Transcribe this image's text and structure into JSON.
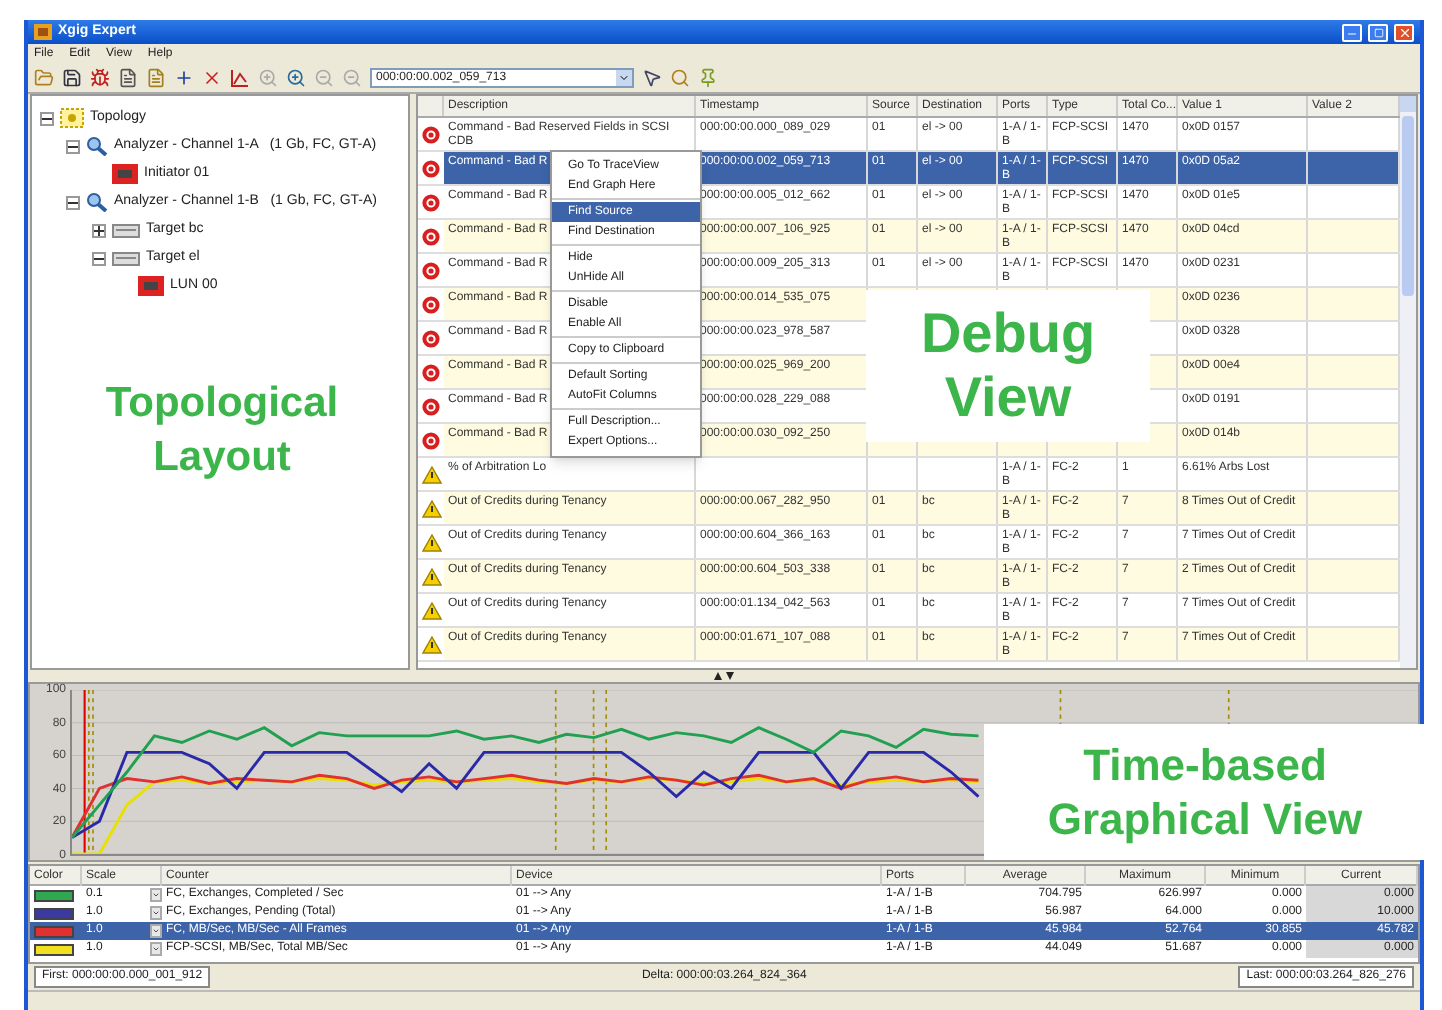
{
  "window": {
    "title": "Xgig Expert"
  },
  "menu": [
    "File",
    "Edit",
    "View",
    "Help"
  ],
  "toolbar": {
    "time_field": "000:00:00.002_059_713"
  },
  "tree": {
    "items": [
      {
        "label": "Topology",
        "kind": "topology",
        "expanded": true,
        "children": [
          {
            "label": "Analyzer - Channel 1-A   (1 Gb, FC, GT-A)",
            "kind": "analyzer",
            "expanded": true,
            "children": [
              {
                "label": "Initiator 01",
                "kind": "initiator"
              }
            ]
          },
          {
            "label": "Analyzer - Channel 1-B   (1 Gb, FC, GT-A)",
            "kind": "analyzer",
            "expanded": true,
            "children": [
              {
                "label": "Target bc",
                "kind": "target",
                "expanded": false
              },
              {
                "label": "Target el",
                "kind": "target",
                "expanded": true,
                "children": [
                  {
                    "label": "LUN 00",
                    "kind": "lun"
                  }
                ]
              }
            ]
          }
        ]
      }
    ],
    "callout": "Topological Layout"
  },
  "events": {
    "columns": [
      "Description",
      "Timestamp",
      "Source",
      "Destination",
      "Ports",
      "Type",
      "Total Co...",
      "Value 1",
      "Value 2"
    ],
    "rows": [
      {
        "kind": "error",
        "selected": false,
        "description": "Command - Bad Reserved Fields in SCSI CDB",
        "timestamp": "000:00:00.000_089_029",
        "source": "01",
        "destination": "el -> 00",
        "ports": "1-A / 1-B",
        "type": "FCP-SCSI",
        "total": "1470",
        "value_1": "0x0D 0157"
      },
      {
        "kind": "error",
        "selected": true,
        "description": "Command - Bad R",
        "timestamp": "000:00:00.002_059_713",
        "source": "01",
        "destination": "el -> 00",
        "ports": "1-A / 1-B",
        "type": "FCP-SCSI",
        "total": "1470",
        "value_1": "0x0D 05a2"
      },
      {
        "kind": "error",
        "selected": false,
        "description": "Command - Bad R",
        "timestamp": "000:00:00.005_012_662",
        "source": "01",
        "destination": "el -> 00",
        "ports": "1-A / 1-B",
        "type": "FCP-SCSI",
        "total": "1470",
        "value_1": "0x0D 01e5"
      },
      {
        "kind": "error",
        "selected": false,
        "description": "Command - Bad R",
        "timestamp": "000:00:00.007_106_925",
        "source": "01",
        "destination": "el -> 00",
        "ports": "1-A / 1-B",
        "type": "FCP-SCSI",
        "total": "1470",
        "value_1": "0x0D 04cd"
      },
      {
        "kind": "error",
        "selected": false,
        "description": "Command - Bad R",
        "timestamp": "000:00:00.009_205_313",
        "source": "01",
        "destination": "el -> 00",
        "ports": "1-A / 1-B",
        "type": "FCP-SCSI",
        "total": "1470",
        "value_1": "0x0D 0231"
      },
      {
        "kind": "error",
        "selected": false,
        "description": "Command - Bad R",
        "timestamp": "000:00:00.014_535_075",
        "value_1": "0x0D 0236"
      },
      {
        "kind": "error",
        "selected": false,
        "description": "Command - Bad R",
        "timestamp": "000:00:00.023_978_587",
        "value_1": "0x0D 0328"
      },
      {
        "kind": "error",
        "selected": false,
        "description": "Command - Bad R",
        "timestamp": "000:00:00.025_969_200",
        "value_1": "0x0D 00e4"
      },
      {
        "kind": "error",
        "selected": false,
        "description": "Command - Bad R",
        "timestamp": "000:00:00.028_229_088",
        "value_1": "0x0D 0191"
      },
      {
        "kind": "error",
        "selected": false,
        "description": "Command - Bad R",
        "timestamp": "000:00:00.030_092_250",
        "value_1": "0x0D 014b"
      },
      {
        "kind": "warning",
        "selected": false,
        "description": "% of Arbitration Lo",
        "ports": "1-A / 1-B",
        "type": "FC-2",
        "total": "1",
        "value_1": "6.61% Arbs Lost"
      },
      {
        "kind": "warning",
        "selected": false,
        "description": "Out of Credits during Tenancy",
        "timestamp": "000:00:00.067_282_950",
        "source": "01",
        "destination": "bc",
        "ports": "1-A / 1-B",
        "type": "FC-2",
        "total": "7",
        "value_1": "8 Times Out of Credit"
      },
      {
        "kind": "warning",
        "selected": false,
        "description": "Out of Credits during Tenancy",
        "timestamp": "000:00:00.604_366_163",
        "source": "01",
        "destination": "bc",
        "ports": "1-A / 1-B",
        "type": "FC-2",
        "total": "7",
        "value_1": "7 Times Out of Credit"
      },
      {
        "kind": "warning",
        "selected": false,
        "description": "Out of Credits during Tenancy",
        "timestamp": "000:00:00.604_503_338",
        "source": "01",
        "destination": "bc",
        "ports": "1-A / 1-B",
        "type": "FC-2",
        "total": "7",
        "value_1": "2 Times Out of Credit"
      },
      {
        "kind": "warning",
        "selected": false,
        "description": "Out of Credits during Tenancy",
        "timestamp": "000:00:01.134_042_563",
        "source": "01",
        "destination": "bc",
        "ports": "1-A / 1-B",
        "type": "FC-2",
        "total": "7",
        "value_1": "7 Times Out of Credit"
      },
      {
        "kind": "warning",
        "selected": false,
        "description": "Out of Credits during Tenancy",
        "timestamp": "000:00:01.671_107_088",
        "source": "01",
        "destination": "bc",
        "ports": "1-A / 1-B",
        "type": "FC-2",
        "total": "7",
        "value_1": "7 Times Out of Credit"
      }
    ],
    "context_menu": {
      "groups": [
        [
          {
            "label": "Go To TraceView",
            "selected": false
          },
          {
            "label": "End Graph Here",
            "selected": false
          }
        ],
        [
          {
            "label": "Find Source",
            "selected": true
          },
          {
            "label": "Find Destination",
            "selected": false
          }
        ],
        [
          {
            "label": "Hide",
            "selected": false
          },
          {
            "label": "UnHide All",
            "selected": false
          }
        ],
        [
          {
            "label": "Disable",
            "selected": false
          },
          {
            "label": "Enable All",
            "selected": false
          }
        ],
        [
          {
            "label": "Copy to Clipboard",
            "selected": false
          }
        ],
        [
          {
            "label": "Default Sorting",
            "selected": false
          },
          {
            "label": "AutoFit Columns",
            "selected": false
          }
        ],
        [
          {
            "label": "Full Description...",
            "selected": false
          },
          {
            "label": "Expert Options...",
            "selected": false
          }
        ]
      ]
    },
    "callout": "Debug View"
  },
  "graph": {
    "chart_data": {
      "type": "line",
      "grid": true,
      "ylim": [
        0,
        100
      ],
      "yticks": [
        0,
        20,
        40,
        60,
        80,
        100
      ],
      "series": [
        {
          "color": "#20a050",
          "values": [
            10,
            30,
            50,
            72,
            68,
            75,
            70,
            77,
            66,
            74,
            72,
            72,
            72,
            72,
            75,
            70,
            72,
            68,
            73,
            71,
            76,
            70,
            74,
            72,
            68,
            77,
            70,
            62,
            75,
            72,
            65,
            76,
            73,
            72,
            null,
            null,
            null,
            null,
            null,
            null,
            null,
            null,
            null,
            null,
            null,
            null,
            null,
            null,
            null,
            null
          ]
        },
        {
          "color": "#2a2aa8",
          "values": [
            10,
            20,
            62,
            62,
            62,
            55,
            40,
            62,
            62,
            62,
            62,
            50,
            38,
            55,
            40,
            62,
            62,
            62,
            62,
            62,
            62,
            50,
            35,
            50,
            40,
            62,
            62,
            62,
            40,
            62,
            62,
            62,
            50,
            35,
            null,
            null,
            null,
            null,
            null,
            null,
            null,
            null,
            null,
            null,
            null,
            null,
            null,
            null,
            null,
            null
          ]
        },
        {
          "color": "#e03030",
          "values": [
            10,
            40,
            46,
            44,
            47,
            43,
            46,
            45,
            44,
            48,
            46,
            40,
            45,
            47,
            44,
            46,
            48,
            45,
            43,
            46,
            44,
            47,
            45,
            42,
            46,
            48,
            44,
            46,
            40,
            45,
            47,
            44,
            46,
            45,
            null,
            null,
            null,
            null,
            null,
            null,
            null,
            null,
            null,
            null,
            null,
            null,
            null,
            null,
            null,
            null
          ]
        },
        {
          "color": "#e8e000",
          "values": [
            0,
            0,
            30,
            44,
            45,
            43,
            44,
            45,
            44,
            46,
            45,
            42,
            44,
            45,
            44,
            45,
            46,
            44,
            43,
            45,
            44,
            46,
            45,
            43,
            44,
            46,
            44,
            45,
            42,
            44,
            45,
            44,
            45,
            44,
            null,
            null,
            null,
            null,
            null,
            null,
            null,
            null,
            null,
            null,
            null,
            null,
            null,
            null,
            null,
            null
          ]
        }
      ]
    },
    "callout": "Time-based Graphical View"
  },
  "counters": {
    "columns": [
      "Color",
      "Scale",
      "Counter",
      "Device",
      "Ports",
      "Average",
      "Maximum",
      "Minimum",
      "Current"
    ],
    "rows": [
      {
        "color": "#2fa84f",
        "selected": false,
        "scale": "0.1",
        "counter": "FC, Exchanges, Completed / Sec",
        "device": "01 --> Any",
        "ports": "1-A / 1-B",
        "average": "704.795",
        "maximum": "626.997",
        "minimum": "0.000",
        "current": "0.000"
      },
      {
        "color": "#3a3aa0",
        "selected": false,
        "scale": "1.0",
        "counter": "FC, Exchanges, Pending (Total)",
        "device": "01 --> Any",
        "ports": "1-A / 1-B",
        "average": "56.987",
        "maximum": "64.000",
        "minimum": "0.000",
        "current": "10.000"
      },
      {
        "color": "#e03030",
        "selected": true,
        "scale": "1.0",
        "counter": "FC, MB/Sec, MB/Sec - All Frames",
        "device": "01 --> Any",
        "ports": "1-A / 1-B",
        "average": "45.984",
        "maximum": "52.764",
        "minimum": "30.855",
        "current": "45.782"
      },
      {
        "color": "#f0e020",
        "selected": false,
        "scale": "1.0",
        "counter": "FCP-SCSI, MB/Sec, Total MB/Sec",
        "device": "01 --> Any",
        "ports": "1-A / 1-B",
        "average": "44.049",
        "maximum": "51.687",
        "minimum": "0.000",
        "current": "0.000"
      }
    ]
  },
  "footer": {
    "first": "First: 000:00:00.000_001_912",
    "delta": "Delta: 000:00:03.264_824_364",
    "last": "Last: 000:00:03.264_826_276"
  }
}
